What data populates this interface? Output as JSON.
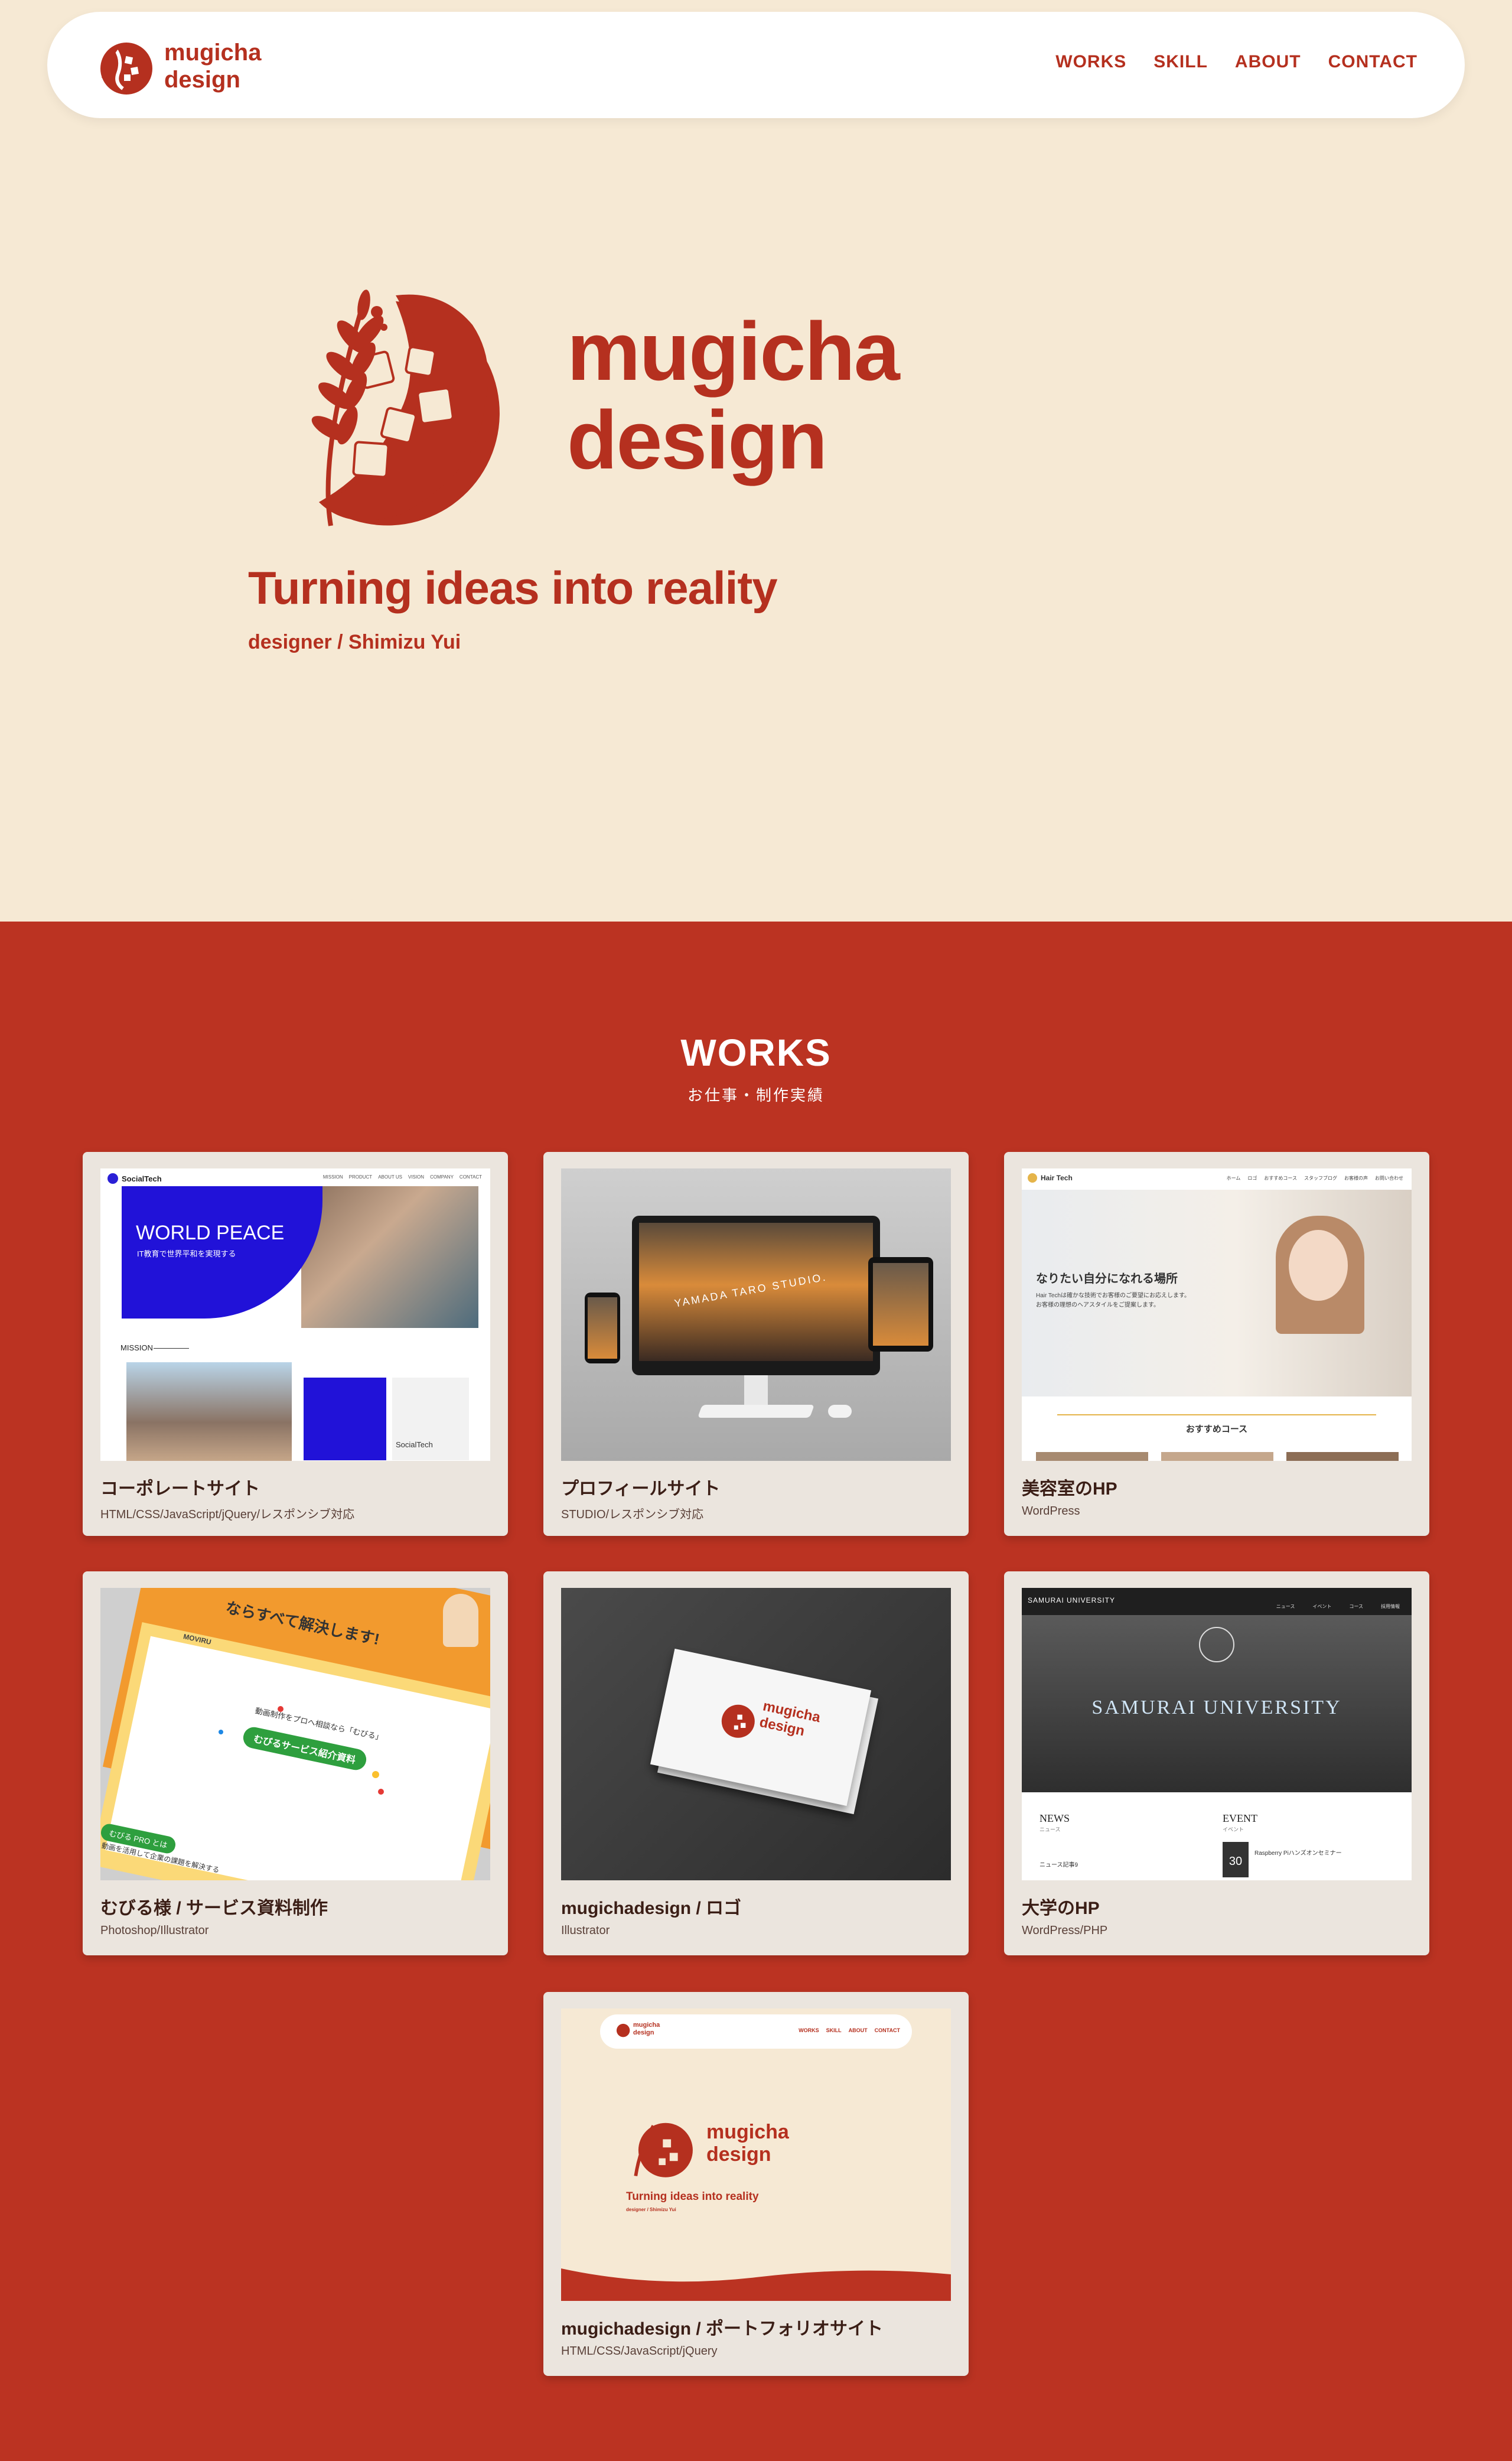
{
  "header": {
    "brand_line1": "mugicha",
    "brand_line2": "design",
    "nav": [
      "WORKS",
      "SKILL",
      "ABOUT",
      "CONTACT"
    ]
  },
  "hero": {
    "brand_line1": "mugicha",
    "brand_line2": "design",
    "tagline": "Turning ideas into reality",
    "byline": "designer / Shimizu Yui"
  },
  "works": {
    "title": "WORKS",
    "subtitle": "お仕事・制作実績",
    "items": [
      {
        "title": "コーポレートサイト",
        "tags": "HTML/CSS/JavaScript/jQuery/レスポンシブ対応",
        "thumb": {
          "brand": "SocialTech",
          "nav": [
            "MISSION",
            "PRODUCT",
            "ABOUT US",
            "VISION",
            "COMPANY",
            "CONTACT"
          ],
          "headline": "WORLD PEACE",
          "subline": "IT教育で世界平和を実現する",
          "section": "MISSION",
          "card_text": "SocialTech"
        }
      },
      {
        "title": "プロフィールサイト",
        "tags": "STUDIO/レスポンシブ対応",
        "thumb": {
          "screen_text": "YAMADA TARO STUDIO."
        }
      },
      {
        "title": "美容室のHP",
        "tags": "WordPress",
        "thumb": {
          "brand": "Hair Tech",
          "nav": [
            "ホーム",
            "ロゴ",
            "おすすめコース",
            "スタッフブログ",
            "お客様の声",
            "お問い合わせ"
          ],
          "headline": "なりたい自分になれる場所",
          "body1": "Hair Techは確かな技術でお客様のご要望にお応えします。",
          "body2": "お客様の理想のヘアスタイルをご提案します。",
          "section": "おすすめコース"
        }
      },
      {
        "title": "むびる様 / サービス資料制作",
        "tags": "Photoshop/Illustrator",
        "thumb": {
          "banner": "ならすべて解決します!",
          "brand": "MOVIRU",
          "line1": "動画制作をプロへ相談なら「むびる」",
          "pill": "むびるサービス紹介資料",
          "badge": "むびる PRO とは",
          "line2": "動画を活用して企業の課題を解決する"
        }
      },
      {
        "title": "mugichadesign / ロゴ",
        "tags": "Illustrator",
        "thumb": {
          "brand1": "mugicha",
          "brand2": "design"
        }
      },
      {
        "title": "大学のHP",
        "tags": "WordPress/PHP",
        "thumb": {
          "brand": "SAMURAI UNIVERSITY",
          "nav": [
            "ニュース",
            "イベント",
            "コース",
            "採用情報"
          ],
          "hero": "SAMURAI UNIVERSITY",
          "news": "NEWS",
          "news_sub": "ニュース",
          "news_item": "ニュース記事9",
          "event": "EVENT",
          "event_sub": "イベント",
          "event_item": "Raspberry Piハンズオンセミナー",
          "event_day": "30"
        }
      },
      {
        "title": "mugichadesign / ポートフォリオサイト",
        "tags": "HTML/CSS/JavaScript/jQuery",
        "thumb": {
          "brand1": "mugicha",
          "brand2": "design",
          "nav": [
            "WORKS",
            "SKILL",
            "ABOUT",
            "CONTACT"
          ],
          "tagline": "Turning ideas into reality",
          "byline": "designer / Shimizu Yui"
        }
      }
    ]
  },
  "colors": {
    "brand_red": "#b5301f",
    "background_red": "#bb3322",
    "cream": "#f6e9d4",
    "card": "#ebe5de"
  }
}
